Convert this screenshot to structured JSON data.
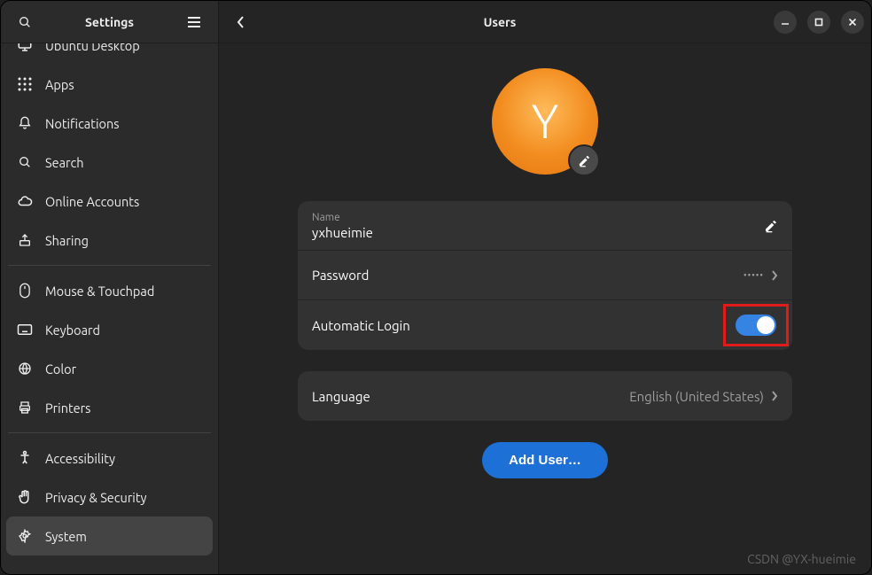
{
  "sidebar": {
    "title": "Settings",
    "items": [
      {
        "label": "Ubuntu Desktop",
        "icon": "display"
      },
      {
        "label": "Apps",
        "icon": "grid"
      },
      {
        "label": "Notifications",
        "icon": "bell"
      },
      {
        "label": "Search",
        "icon": "search"
      },
      {
        "label": "Online Accounts",
        "icon": "cloud"
      },
      {
        "label": "Sharing",
        "icon": "share"
      }
    ],
    "items2": [
      {
        "label": "Mouse & Touchpad",
        "icon": "mouse"
      },
      {
        "label": "Keyboard",
        "icon": "keyboard"
      },
      {
        "label": "Color",
        "icon": "globe"
      },
      {
        "label": "Printers",
        "icon": "printer"
      }
    ],
    "items3": [
      {
        "label": "Accessibility",
        "icon": "accessibility"
      },
      {
        "label": "Privacy & Security",
        "icon": "hand"
      },
      {
        "label": "System",
        "icon": "gear"
      }
    ],
    "activeIndex": "items3.2"
  },
  "header": {
    "title": "Users"
  },
  "user": {
    "avatar_letter": "Y",
    "name_label": "Name",
    "name_value": "yxhueimie",
    "password_label": "Password",
    "password_masked": "•••••",
    "autologin_label": "Automatic Login",
    "autologin_on": true,
    "language_label": "Language",
    "language_value": "English (United States)"
  },
  "actions": {
    "add_user": "Add User…"
  },
  "watermark": "CSDN @YX-hueimie"
}
